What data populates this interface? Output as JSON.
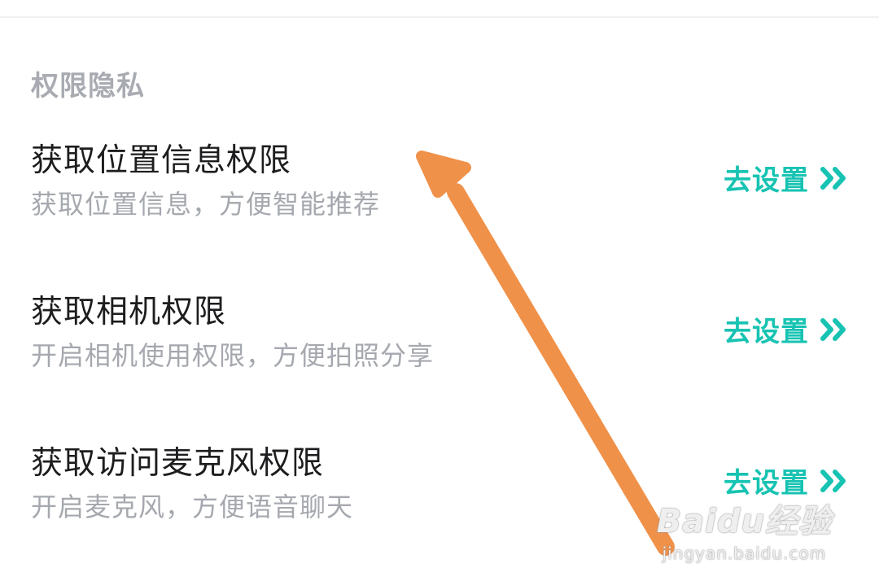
{
  "section": {
    "title": "权限隐私"
  },
  "permissions": [
    {
      "title": "获取位置信息权限",
      "subtitle": "获取位置信息，方便智能推荐",
      "action_label": "去设置",
      "action_icon": "double-chevron-right-icon"
    },
    {
      "title": "获取相机权限",
      "subtitle": "开启相机使用权限，方便拍照分享",
      "action_label": "去设置",
      "action_icon": "double-chevron-right-icon"
    },
    {
      "title": "获取访问麦克风权限",
      "subtitle": "开启麦克风，方便语音聊天",
      "action_label": "去设置",
      "action_icon": "double-chevron-right-icon"
    }
  ],
  "colors": {
    "accent": "#17c3b2",
    "annotation_arrow": "#f0914a",
    "title_text": "#1d1d1f",
    "subtitle_text": "#a5a8ae",
    "section_text": "#a9abb2"
  },
  "watermark": {
    "logo": "Baidu经验",
    "url": "jingyan.baidu.com"
  }
}
